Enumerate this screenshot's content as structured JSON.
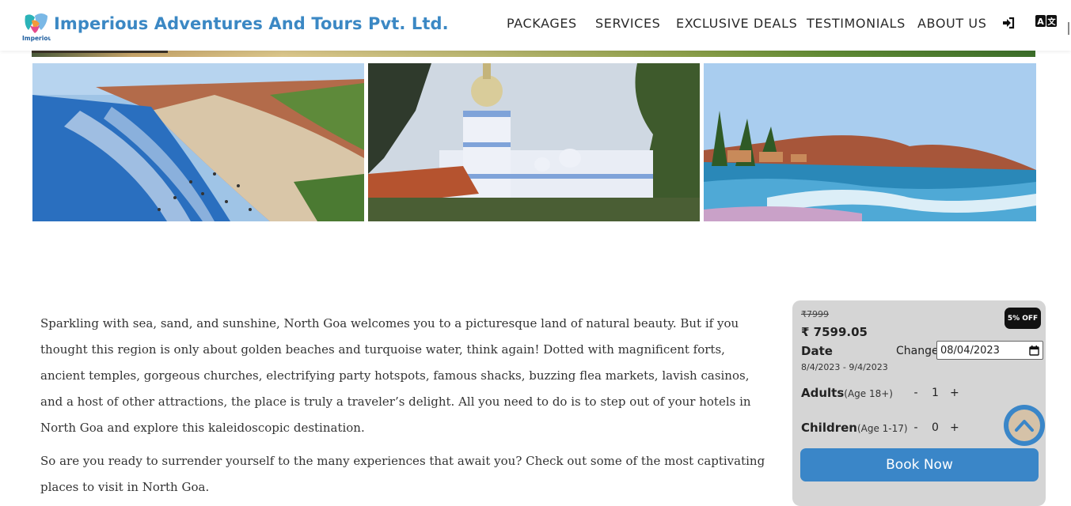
{
  "header": {
    "brand": "Imperious Adventures And Tours Pvt. Ltd.",
    "logo_text": "Imperious",
    "nav": [
      "PACKAGES",
      "SERVICES",
      "EXCLUSIVE DEALS",
      "TESTIMONIALS",
      "ABOUT US"
    ],
    "icons": [
      "login-icon",
      "translate-icon"
    ]
  },
  "gallery": {
    "images": [
      "beach-coast-photo",
      "white-church-photo",
      "beach-waves-photo"
    ]
  },
  "description": {
    "paragraph1": "Sparkling with sea, sand, and sunshine, North Goa welcomes you to a picturesque land of natural beauty. But if you thought this region is only about golden beaches and turquoise water, think again! Dotted with magnificent forts, ancient temples, gorgeous churches, electrifying party hotspots, famous shacks, buzzing flea markets, lavish casinos, and a host of other attractions, the place is truly a traveler’s delight. All you need to do is to step out of your hotels in North Goa and explore this kaleidoscopic destination.",
    "paragraph2": "So are you ready to surrender yourself to the many experiences that await you? Check out some of the most captivating places to visit in North Goa."
  },
  "booking": {
    "old_price": "₹7999",
    "new_price": "₹ 7599.05",
    "discount": "5% OFF",
    "date_label": "Date",
    "change_label": "Change",
    "date_value": "08/04/2023",
    "date_range": "8/4/2023 - 9/4/2023",
    "adults_label": "Adults",
    "adults_age": "(Age 18+)",
    "adults_count": "1",
    "children_label": "Children",
    "children_age": "(Age 1-17)",
    "children_count": "0",
    "minus": "-",
    "plus": "+",
    "book_button": "Book Now"
  },
  "colors": {
    "brand": "#3b88c4",
    "card": "#d5d5d5",
    "button": "#3a86c8"
  }
}
